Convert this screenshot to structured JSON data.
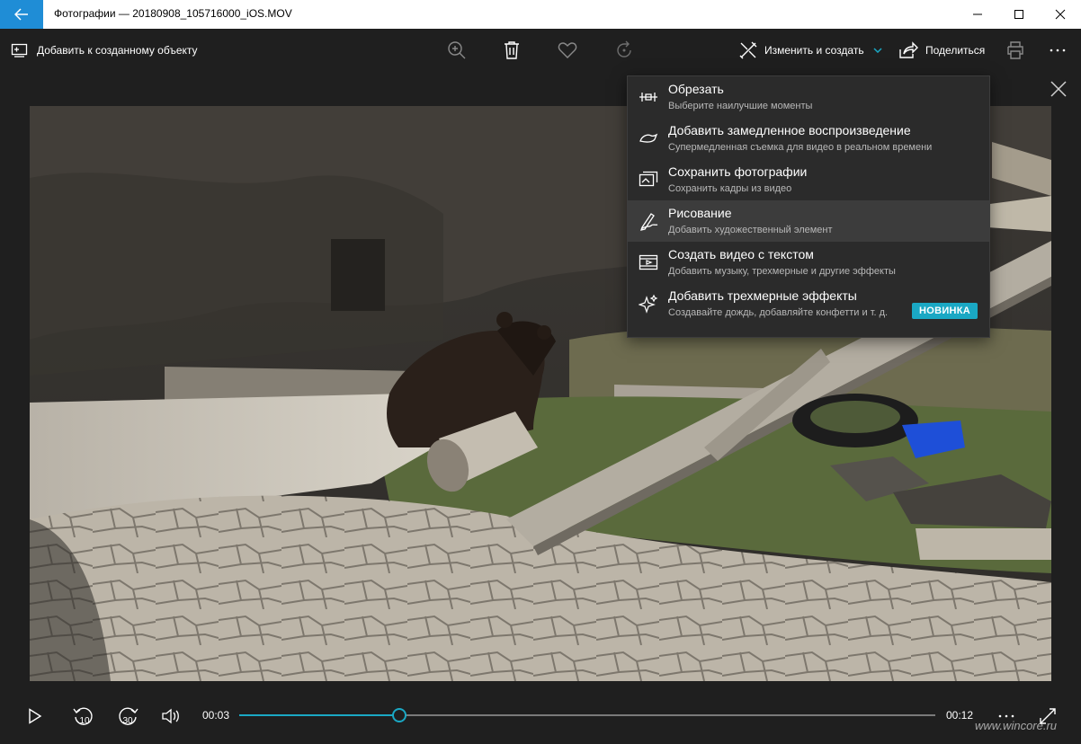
{
  "window": {
    "title": "Фотографии — 20180908_105716000_iOS.MOV"
  },
  "cmdbar": {
    "add_to_creation": "Добавить к созданному объекту",
    "edit_create": "Изменить и создать",
    "share": "Поделиться"
  },
  "menu": {
    "items": [
      {
        "title": "Обрезать",
        "subtitle": "Выберите наилучшие моменты",
        "icon": "trim-icon"
      },
      {
        "title": "Добавить замедленное воспроизведение",
        "subtitle": "Супермедленная съемка для видео в реальном времени",
        "icon": "slow-motion-icon"
      },
      {
        "title": "Сохранить фотографии",
        "subtitle": "Сохранить кадры из видео",
        "icon": "save-photos-icon"
      },
      {
        "title": "Рисование",
        "subtitle": "Добавить художественный элемент",
        "icon": "draw-icon"
      },
      {
        "title": "Создать видео с текстом",
        "subtitle": "Добавить музыку, трехмерные и другие эффекты",
        "icon": "video-text-icon"
      },
      {
        "title": "Добавить трехмерные эффекты",
        "subtitle": "Создавайте дождь, добавляйте конфетти и т. д.",
        "icon": "sparkle-icon"
      }
    ],
    "new_badge": "НОВИНКА",
    "highlighted_index": 3
  },
  "player": {
    "current_time": "00:03",
    "total_time": "00:12",
    "progress": 0.23,
    "rewind_label": "10",
    "forward_label": "30"
  },
  "watermark": "www.wincore.ru",
  "colors": {
    "accent": "#1aa8c4",
    "titlebar_back": "#1f8dd6",
    "background": "#1f1f1f"
  }
}
